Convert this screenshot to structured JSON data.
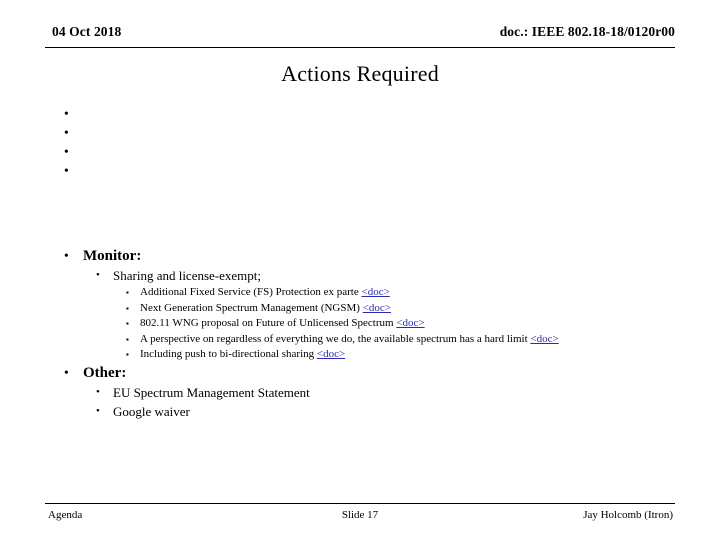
{
  "header": {
    "date": "04 Oct 2018",
    "doc_reference": "doc.: IEEE 802.18-18/0120r00"
  },
  "title": "Actions Required",
  "bullet_glyphs": {
    "level1": "•",
    "level2": "•",
    "level3": "▪"
  },
  "body": {
    "empty_bullets": [
      "",
      "",
      "",
      ""
    ],
    "sections": [
      {
        "heading": "Monitor:",
        "sub": [
          {
            "text": "Sharing and license-exempt;",
            "items": [
              {
                "text": "Additional Fixed Service (FS) Protection ex parte ",
                "link": "<doc>"
              },
              {
                "text": "Next Generation Spectrum Management (NGSM) ",
                "link": "<doc>"
              },
              {
                "text": "802.11 WNG proposal on Future of Unlicensed Spectrum ",
                "link": "<doc>"
              },
              {
                "text": "A perspective on regardless of everything we do, the available spectrum has a hard limit ",
                "link": "<doc>"
              },
              {
                "text": "Including push to bi-directional sharing ",
                "link": "<doc>"
              }
            ]
          }
        ]
      },
      {
        "heading": "Other:",
        "sub": [
          {
            "text": "EU Spectrum Management Statement",
            "items": []
          },
          {
            "text": "Google waiver",
            "items": []
          }
        ]
      }
    ]
  },
  "footer": {
    "left": "Agenda",
    "center": "Slide 17",
    "right": "Jay Holcomb (Itron)"
  },
  "colors": {
    "text": "#000000",
    "link": "#2b2bb0",
    "background": "#ffffff"
  }
}
